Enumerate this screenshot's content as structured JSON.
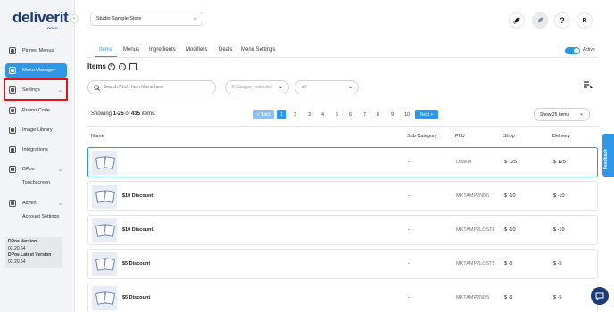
{
  "brand": {
    "name": "deliverit",
    "sub": "GOLO"
  },
  "sidebar": {
    "items": [
      {
        "label": "Pinned Menus",
        "icon": "pin-icon"
      },
      {
        "label": "Menu Manager",
        "icon": "menu-book-icon"
      },
      {
        "label": "Settings",
        "icon": "settings-icon"
      },
      {
        "label": "Promo Code",
        "icon": "promo-icon"
      },
      {
        "label": "Image Library",
        "icon": "image-icon"
      },
      {
        "label": "Integrations",
        "icon": "integrations-icon"
      },
      {
        "label": "DPos",
        "icon": "pos-icon"
      },
      {
        "label": "Admin",
        "icon": "admin-icon"
      }
    ],
    "subitems": {
      "touchscreen": "Touchscreen",
      "account_settings": "Account Settings"
    },
    "version": {
      "dpos_label": "DPos Version",
      "dpos_value": "02.20.64",
      "latest_label": "DPos Latest Version",
      "latest_value": "02.20.64"
    }
  },
  "header": {
    "store": "Studio Sample Store",
    "help": "?",
    "avatar": "R"
  },
  "tabs": [
    "Items",
    "Menus",
    "Ingredients",
    "Modifiers",
    "Deals",
    "Menu Settings"
  ],
  "active_toggle": {
    "label": "Active",
    "on": true
  },
  "items_title": "Items",
  "filters": {
    "search_placeholder": "Search PLU / Item Name here",
    "categories": "0 Categery selected",
    "all": "All"
  },
  "summary": {
    "prefix": "Showing ",
    "range": "1-25",
    "of": " of ",
    "total": "415",
    "suffix": " items."
  },
  "pagination": {
    "back": "« Back",
    "pages": [
      "1",
      "2",
      "3",
      "4",
      "5",
      "6",
      "7",
      "8",
      "9",
      "10"
    ],
    "next": "Next »",
    "per_page": "Show 25 Items"
  },
  "table": {
    "headers": {
      "name": "Name",
      "sub_category": "Sub Category",
      "plu": "PLU",
      "shop": "Shop",
      "delivery": "Delivery"
    },
    "rows": [
      {
        "name": "",
        "sub": "-",
        "plu": "Deal04",
        "shop": "$ 125",
        "delivery": "$ 125"
      },
      {
        "name": "$10 Discount",
        "sub": "-",
        "plu": "MKTAMP2ND6",
        "shop": "$ -10",
        "delivery": "$ -10"
      },
      {
        "name": "$10 Discount.",
        "sub": "-",
        "plu": "MKTAMP2LOST6",
        "shop": "$ -10",
        "delivery": "$ -10"
      },
      {
        "name": "$5 Discount",
        "sub": "-",
        "plu": "MKTAMP2LOST5",
        "shop": "$ -5",
        "delivery": "$ -5"
      },
      {
        "name": "$5 Discount",
        "sub": "-",
        "plu": "MKTAMP2ND5",
        "shop": "$ -5",
        "delivery": "$ -5"
      }
    ]
  },
  "feedback": "Feedback",
  "colors": {
    "accent": "#2e97e8",
    "highlight": "#e0151c",
    "brand": "#1b3a7a"
  }
}
